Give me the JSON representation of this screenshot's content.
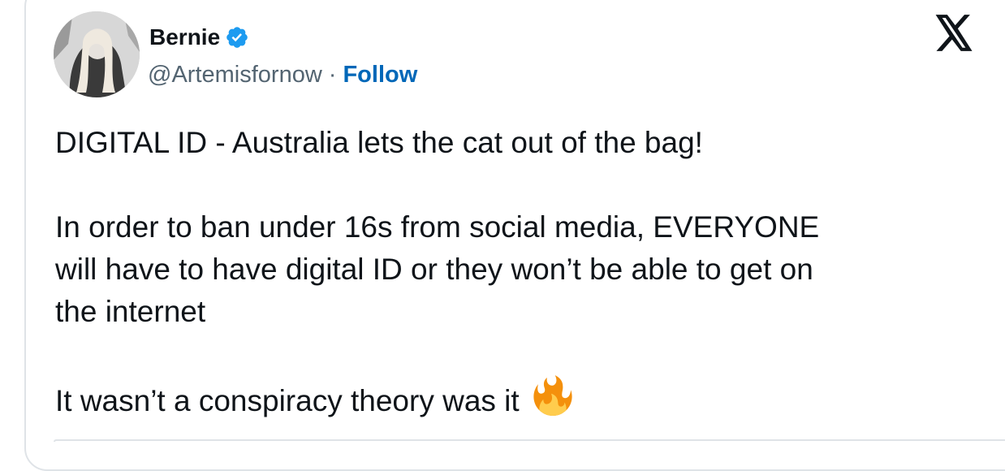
{
  "tweet": {
    "author": {
      "name": "Bernie",
      "handle": "@Artemisfornow",
      "separator": "·",
      "follow_label": "Follow",
      "verified": true,
      "accent_color": "#1d9bf0"
    },
    "platform_icon": "x-logo-icon",
    "text": {
      "line1": "DIGITAL ID - Australia lets the cat out of the bag!",
      "para2_line1": "In order to ban under 16s from social media, EVERYONE",
      "para2_line2": "will have to have digital ID or they won’t be able to get on",
      "para2_line3": "the internet",
      "line_last": "It wasn’t a conspiracy theory was it"
    },
    "emoji": "fire-emoji"
  }
}
